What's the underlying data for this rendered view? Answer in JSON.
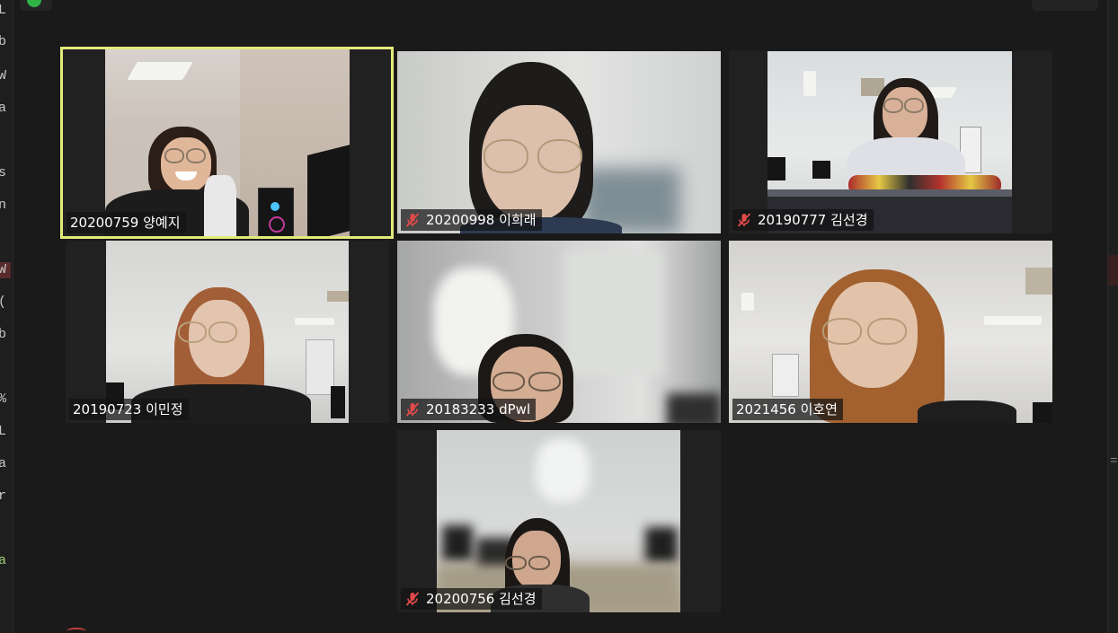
{
  "participants": [
    {
      "id": "20200759",
      "name": "양예지",
      "muted": false,
      "active_speaker": true
    },
    {
      "id": "20200998",
      "name": "이희래",
      "muted": true,
      "active_speaker": false
    },
    {
      "id": "20190777",
      "name": "김선경",
      "muted": true,
      "active_speaker": false
    },
    {
      "id": "20190723",
      "name": "이민정",
      "muted": false,
      "active_speaker": false
    },
    {
      "id": "20183233",
      "name": "dPwl",
      "muted": true,
      "active_speaker": false
    },
    {
      "id": "2021456",
      "name": "이호연",
      "muted": false,
      "active_speaker": false
    },
    {
      "id": "20200756",
      "name": "김선경",
      "muted": true,
      "active_speaker": false
    }
  ],
  "labels": {
    "p0": "20200759 양예지",
    "p1": "20200998 이희래",
    "p2": "20190777 김선경",
    "p3": "20190723 이민정",
    "p4": "20183233 dPwl",
    "p5": "2021456 이호연",
    "p6": "20200756 김선경"
  },
  "colors": {
    "background": "#1a1a1a",
    "tile": "#212121",
    "active_speaker_border": "#e3ea7a",
    "muted_icon": "#e24a4a",
    "status_dot": "#2fb344"
  },
  "icons": {
    "muted": "mic-off-icon",
    "status": "status-dot-icon"
  },
  "background_code_glyphs": [
    "L",
    "b",
    "W",
    "a",
    "s",
    "n",
    "W",
    "(",
    "b",
    "%",
    "L",
    "a",
    "r",
    "a"
  ]
}
